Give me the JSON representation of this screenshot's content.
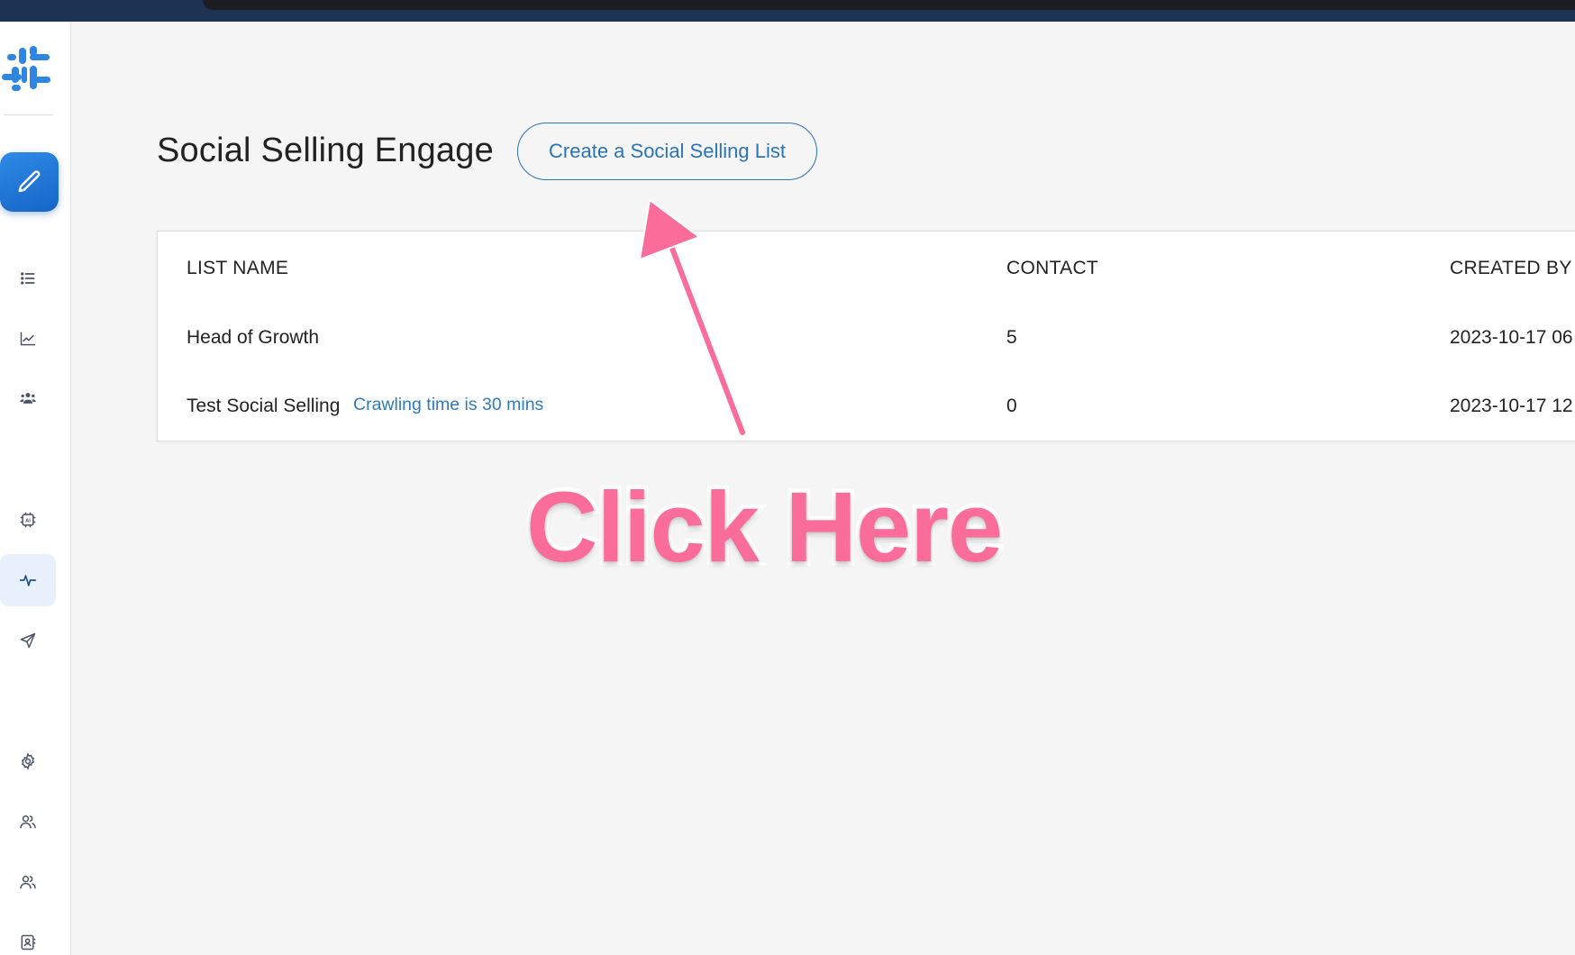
{
  "sidebar": {
    "compose_icon": "pencil-icon",
    "items": [
      {
        "name": "list-icon",
        "active": false
      },
      {
        "name": "analytics-chart-icon",
        "active": false
      },
      {
        "name": "team-icon",
        "active": false
      },
      {
        "name": "ai-chip-icon",
        "active": false
      },
      {
        "name": "activity-pulse-icon",
        "active": true
      },
      {
        "name": "send-icon",
        "active": false
      },
      {
        "name": "settings-gear-icon",
        "active": false
      },
      {
        "name": "user-group-icon",
        "active": false
      },
      {
        "name": "users-icon",
        "active": false
      },
      {
        "name": "contact-book-icon",
        "active": false
      }
    ]
  },
  "header": {
    "title": "Social Selling Engage",
    "create_button_label": "Create a Social Selling List"
  },
  "table": {
    "columns": [
      "LIST NAME",
      "CONTACT",
      "CREATED BY"
    ],
    "rows": [
      {
        "name": "Head of Growth",
        "note": "",
        "contact": "5",
        "created": "2023-10-17 06"
      },
      {
        "name": "Test Social Selling",
        "note": "Crawling time is 30 mins",
        "contact": "0",
        "created": "2023-10-17 12"
      }
    ]
  },
  "annotation": {
    "text": "Click Here",
    "color": "#fa6d9a"
  },
  "colors": {
    "accent": "#2b74b6",
    "primary_button": "#1e73d6",
    "topbar": "#1e3354"
  }
}
